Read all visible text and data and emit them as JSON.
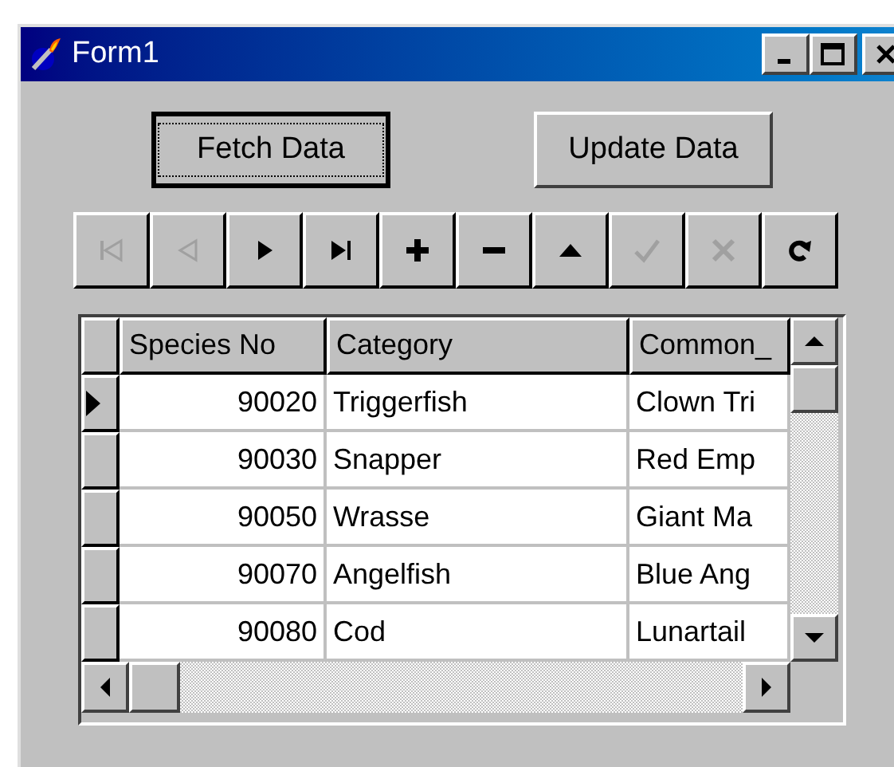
{
  "window": {
    "title": "Form1"
  },
  "buttons": [
    {
      "label": "Fetch Data",
      "focused": true
    },
    {
      "label": "Update Data",
      "focused": false
    }
  ],
  "navigator": [
    {
      "kind": "first",
      "disabled": true
    },
    {
      "kind": "prior",
      "disabled": true
    },
    {
      "kind": "next",
      "disabled": false
    },
    {
      "kind": "last",
      "disabled": false
    },
    {
      "kind": "insert",
      "disabled": false
    },
    {
      "kind": "delete",
      "disabled": false
    },
    {
      "kind": "edit",
      "disabled": false
    },
    {
      "kind": "post",
      "disabled": true
    },
    {
      "kind": "cancel",
      "disabled": true
    },
    {
      "kind": "refresh",
      "disabled": false
    }
  ],
  "grid": {
    "columns": [
      "Species No",
      "Category",
      "Common_"
    ],
    "rows": [
      {
        "cells": [
          "90020",
          "Triggerfish",
          "Clown Tri"
        ],
        "selected": true
      },
      {
        "cells": [
          "90030",
          "Snapper",
          "Red Emp"
        ],
        "selected": false
      },
      {
        "cells": [
          "90050",
          "Wrasse",
          "Giant Ma"
        ],
        "selected": false
      },
      {
        "cells": [
          "90070",
          "Angelfish",
          "Blue Ang"
        ],
        "selected": false
      },
      {
        "cells": [
          "90080",
          "Cod",
          "Lunartail"
        ],
        "selected": false
      }
    ]
  }
}
